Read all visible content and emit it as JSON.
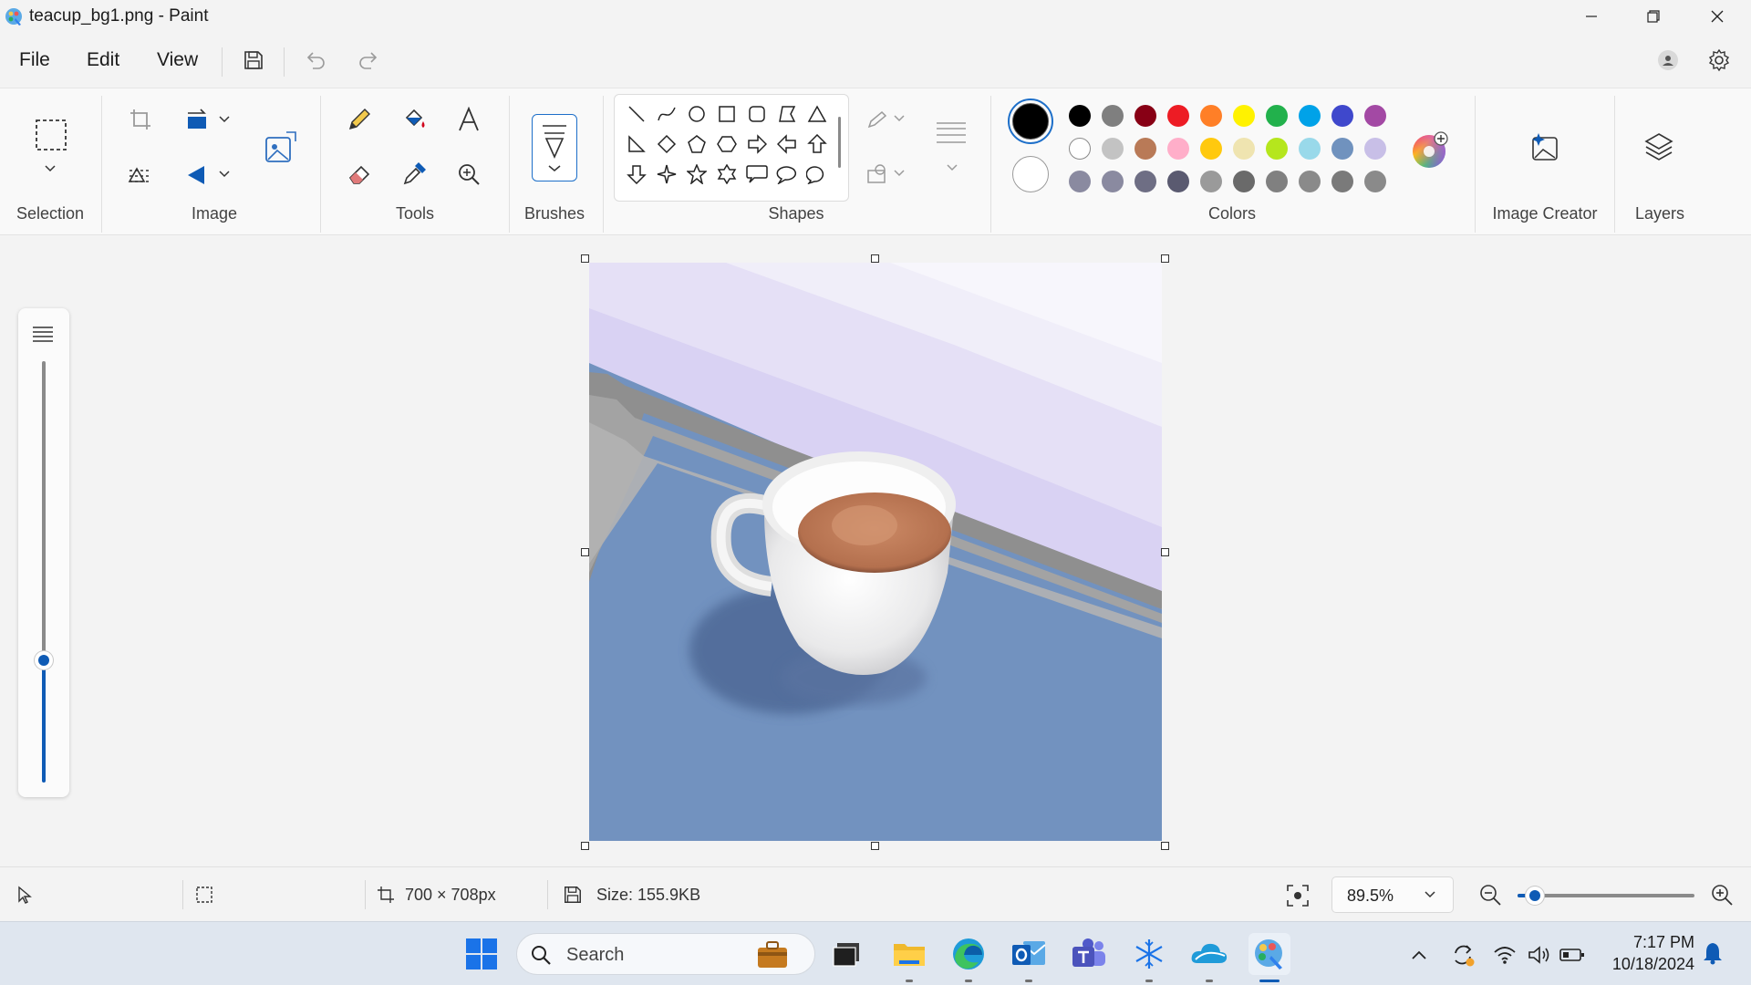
{
  "window": {
    "title": "teacup_bg1.png - Paint",
    "app_icon": "paint-icon",
    "controls": [
      "minimize-icon",
      "restore-icon",
      "close-icon"
    ]
  },
  "menu": {
    "items": [
      "File",
      "Edit",
      "View"
    ],
    "save_icon": "save-icon",
    "undo_icon": "undo-icon",
    "redo_icon": "redo-icon",
    "account_icon": "account-icon",
    "settings_icon": "gear-icon"
  },
  "ribbon": {
    "groups": {
      "selection": "Selection",
      "image": "Image",
      "tools": "Tools",
      "brushes": "Brushes",
      "shapes": "Shapes",
      "colors": "Colors",
      "image_creator": "Image Creator",
      "layers": "Layers"
    },
    "shapes": [
      "line",
      "curve",
      "oval",
      "rectangle",
      "rounded-rectangle",
      "polygon",
      "triangle",
      "right-triangle",
      "diamond",
      "pentagon",
      "hexagon",
      "right-arrow",
      "left-arrow",
      "up-arrow",
      "down-arrow",
      "four-point-star",
      "five-point-star",
      "six-point-star",
      "rounded-callout",
      "oval-callout",
      "cloud-callout"
    ],
    "colors": {
      "primary": "#000000",
      "secondary": "#ffffff",
      "palette_row1": [
        "#000000",
        "#7f7f7f",
        "#880015",
        "#ed1c24",
        "#ff7f27",
        "#fff200",
        "#22b14c",
        "#00a2e8",
        "#3f48cc",
        "#a349a4"
      ],
      "palette_row2": [
        "#ffffff",
        "#c3c3c3",
        "#b97a57",
        "#ffaec9",
        "#ffc90e",
        "#efe4b0",
        "#b5e61d",
        "#99d9ea",
        "#7092be",
        "#c8bfe7"
      ],
      "palette_row3": [
        "#8a8aa0",
        "#8a8aa0",
        "#6e6e84",
        "#5a5a70",
        "#9a9a9a",
        "#6a6a6a",
        "#808080",
        "#8a8a8a",
        "#7a7a7a",
        "#8a8a8a"
      ]
    }
  },
  "status": {
    "dimensions": "700 × 708px",
    "size": "Size: 155.9KB",
    "zoom": "89.5%",
    "zoom_fraction": 0.1
  },
  "taskbar": {
    "search_placeholder": "Search",
    "time": "7:17 PM",
    "date": "10/18/2024"
  }
}
